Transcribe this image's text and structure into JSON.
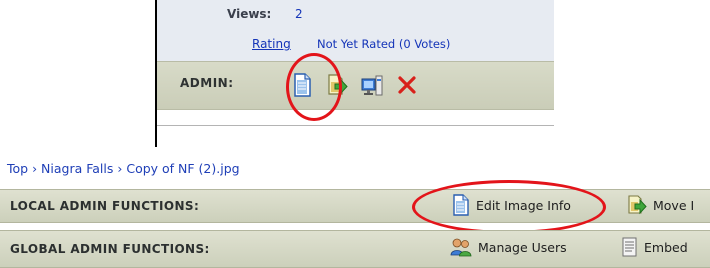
{
  "image_details": {
    "views_label": "Views:",
    "views_value": "2",
    "rating_label": "Rating",
    "rating_value": "Not Yet Rated (0 Votes)"
  },
  "admin_toolbar": {
    "label": "ADMIN:",
    "icons": [
      "edit-info-icon",
      "move-icon",
      "properties-icon",
      "delete-icon"
    ]
  },
  "breadcrumb": {
    "text": "Top › Niagra Falls › Copy of NF (2).jpg"
  },
  "local_admin": {
    "label": "LOCAL ADMIN FUNCTIONS:",
    "edit_image_info": "Edit Image Info",
    "move": "Move I"
  },
  "global_admin": {
    "label": "GLOBAL ADMIN FUNCTIONS:",
    "manage_users": "Manage Users",
    "embed": "Embed"
  },
  "colors": {
    "highlight_circle": "#e3141a",
    "link": "#1434b8",
    "bar": "#cfd2bd"
  }
}
